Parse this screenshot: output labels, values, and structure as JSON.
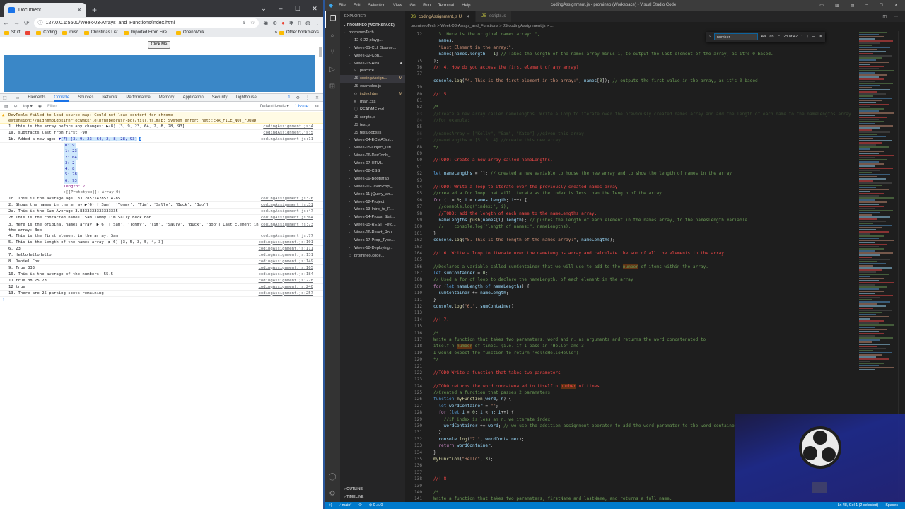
{
  "chrome": {
    "tab_title": "Document",
    "url": "127.0.0.1:5500/Week-03-Arrays_and_Functions/index.html",
    "bookmarks": [
      "Stuff",
      "Coding",
      "misc",
      "Christmas List",
      "Imported From Fire...",
      "Open Work"
    ],
    "other_bookmarks": "Other bookmarks",
    "button_label": "Click Me"
  },
  "devtools": {
    "tabs": [
      "Elements",
      "Console",
      "Sources",
      "Network",
      "Performance",
      "Memory",
      "Application",
      "Security",
      "Lighthouse"
    ],
    "context": "top",
    "filter_placeholder": "Filter",
    "levels": "Default levels",
    "issues": "1 Issue:",
    "issue_count": "1",
    "warning": "DevTools failed to load source map: Could not load content for chrome-extension://alghmmpidokifnrjocwmkkjlelhfnhbebrwsr-pol/fill.js.map: System error: net::ERR_FILE_NOT_FOUND",
    "logs": [
      {
        "text": "1. this is the array before any changes: ▶(8) [3, 9, 23, 64, 2, 8, 28, 93]",
        "src": "codingAssignment.js:4"
      },
      {
        "text": "1a. subtracts last from first -90",
        "src": "codingAssignment.js:5"
      },
      {
        "text": "1b. Added a new age:",
        "src": "codingAssignment.js:11"
      },
      {
        "text": "1c. This is the average age: 33.285714285714285",
        "src": "codingAssignment.js:26"
      },
      {
        "text": "2. Shows the names in the array ▶(6) ['Sam', 'Tommy', 'Tim', 'Sally', 'Buck', 'Bob']",
        "src": "codingAssignment.js:31"
      },
      {
        "text": "2a. This is the Sum Average 3.8333333333333335",
        "src": "codingAssignment.js:47"
      },
      {
        "text": "2b This is the contacted names: Sam Tommy Tim Sally Buck Bob",
        "src": "codingAssignment.js:64"
      },
      {
        "text": "3. Here is the original names array: ▶(6) ['Sam', 'Tommy', 'Tim', 'Sally', 'Buck', 'Bob'] Last Element in the array: Bob",
        "src": "codingAssignment.js:73"
      },
      {
        "text": "4. This is the first element in the array: Sam",
        "src": "codingAssignment.js:77"
      },
      {
        "text": "5. This is the length of the names array: ▶(6) [3, 5, 3, 5, 4, 3]",
        "src": "codingAssignment.js:101"
      },
      {
        "text": "6. 23",
        "src": "codingAssignment.js:111"
      },
      {
        "text": "7. HelloHelloHello",
        "src": "codingAssignment.js:131"
      },
      {
        "text": "8. Daniel Cox",
        "src": "codingAssignment.js:149"
      },
      {
        "text": "9. True 333",
        "src": "codingAssignment.js:165"
      },
      {
        "text": "10. This is the average of the numbers: 55.5",
        "src": "codingAssignment.js:184"
      },
      {
        "text": "11 true 38.75 23",
        "src": "codingAssignment.js:228"
      },
      {
        "text": "12 true",
        "src": "codingAssignment.js:240"
      },
      {
        "text": "13.  There are 25 parking spots remaining.",
        "src": "codingAssignment.js:257"
      }
    ],
    "expanded_array": {
      "header": "(7) [3, 9, 23, 64, 2, 8, 28, 93]",
      "items": [
        "0: 9",
        "1: 23",
        "2: 64",
        "3: 2",
        "4: 8",
        "5: 28",
        "6: 93"
      ],
      "length": "length: 7",
      "proto": "▶[[Prototype]]: Array(0)"
    }
  },
  "vscode": {
    "menu": [
      "File",
      "Edit",
      "Selection",
      "View",
      "Go",
      "Run",
      "Terminal",
      "Help"
    ],
    "window_title": "codingAssignment.js - promineo (Workspace) - Visual Studio Code",
    "explorer_title": "EXPLORER",
    "workspace": "PROMINEO (WORKSPACE)",
    "tree": [
      {
        "label": "promineoTech",
        "kind": "folder-open",
        "level": 0
      },
      {
        "label": "12-6-22-playg...",
        "kind": "folder",
        "level": 1
      },
      {
        "label": "Week-01-CLI_Source...",
        "kind": "folder",
        "level": 1
      },
      {
        "label": "Week-02-Con...",
        "kind": "folder",
        "level": 1
      },
      {
        "label": "Week-03-Arra...",
        "kind": "folder-open",
        "level": 1,
        "mark": "●"
      },
      {
        "label": "practice",
        "kind": "folder",
        "level": 2
      },
      {
        "label": "codingAssign...",
        "kind": "js",
        "level": 2,
        "mark": "M",
        "sel": true
      },
      {
        "label": "examples.js",
        "kind": "js",
        "level": 2
      },
      {
        "label": "index.html",
        "kind": "html",
        "level": 2,
        "mark": "M"
      },
      {
        "label": "main.css",
        "kind": "css",
        "level": 2
      },
      {
        "label": "README.md",
        "kind": "md",
        "level": 2
      },
      {
        "label": "scripts.js",
        "kind": "js",
        "level": 2
      },
      {
        "label": "test.js",
        "kind": "js",
        "level": 2
      },
      {
        "label": "testLoops.js",
        "kind": "js",
        "level": 2
      },
      {
        "label": "Week-04-ECMAScri...",
        "kind": "folder",
        "level": 1
      },
      {
        "label": "Week-05-Object_Ori...",
        "kind": "folder",
        "level": 1
      },
      {
        "label": "Week-06-DevTools_...",
        "kind": "folder",
        "level": 1
      },
      {
        "label": "Week-07-HTML",
        "kind": "folder",
        "level": 1
      },
      {
        "label": "Week-08-CSS",
        "kind": "folder",
        "level": 1
      },
      {
        "label": "Week-09-Bootstrap",
        "kind": "folder",
        "level": 1
      },
      {
        "label": "Week-10-JavaScript_...",
        "kind": "folder",
        "level": 1
      },
      {
        "label": "Week-11-jQuery_an...",
        "kind": "folder",
        "level": 1
      },
      {
        "label": "Week-12-Project",
        "kind": "folder",
        "level": 1
      },
      {
        "label": "Week-13-Intro_to_R...",
        "kind": "folder",
        "level": 1
      },
      {
        "label": "Week-14-Props_Stat...",
        "kind": "folder",
        "level": 1
      },
      {
        "label": "Week-15-REST_Fetc...",
        "kind": "folder",
        "level": 1
      },
      {
        "label": "Week-16-React_Rou...",
        "kind": "folder",
        "level": 1
      },
      {
        "label": "Week-17-Prop_Type...",
        "kind": "folder",
        "level": 1
      },
      {
        "label": "Week-18-Deploying...",
        "kind": "folder",
        "level": 1
      },
      {
        "label": "promineo.code...",
        "kind": "ws",
        "level": 1
      }
    ],
    "outline": "OUTLINE",
    "timeline": "TIMELINE",
    "tabs": [
      {
        "label": "codingAssignment.js",
        "mark": "U",
        "active": true
      },
      {
        "label": "scripts.js",
        "mark": "",
        "active": false
      }
    ],
    "breadcrumb": "promineoTech > Week-03-Arrays_and_Functions > JS codingAssignment.js > ...",
    "find": {
      "value": "number",
      "count": "28 of 42"
    },
    "status": {
      "branch": "main*",
      "sync": "⟳",
      "errors": "⊗ 0 ⚠ 0",
      "position": "Ln 48, Col 1 (2 selected)",
      "spaces": "Spaces"
    }
  }
}
